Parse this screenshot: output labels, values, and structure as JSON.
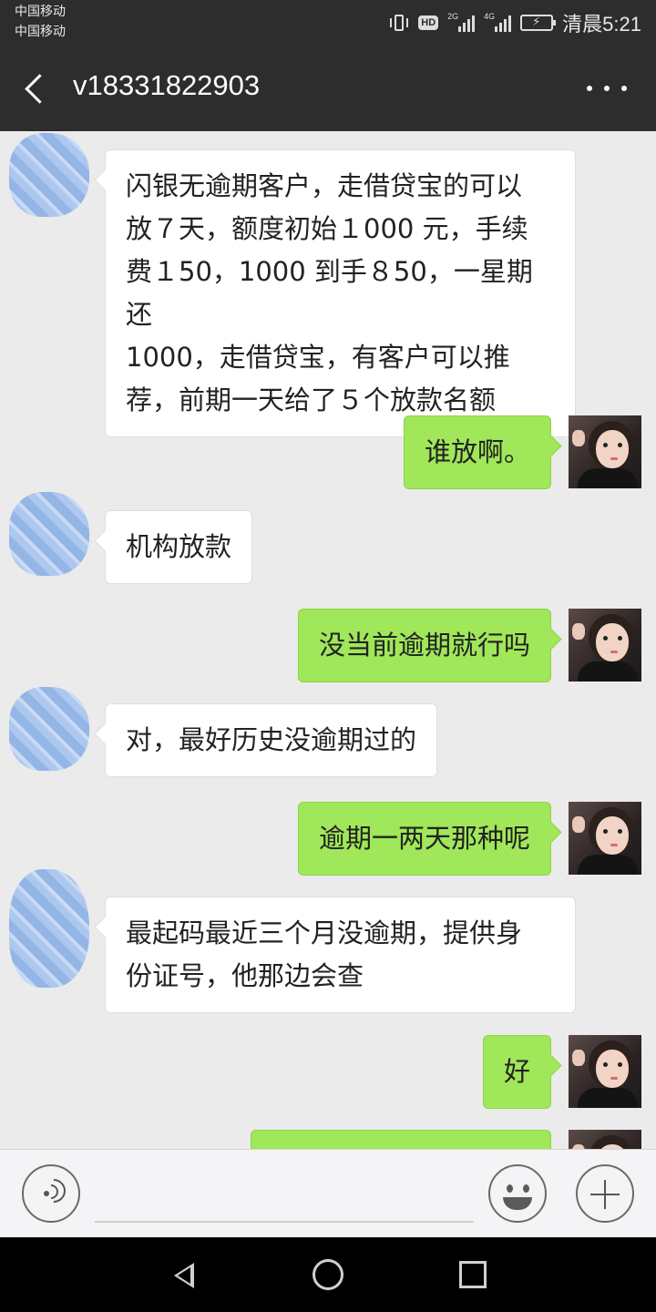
{
  "status_bar": {
    "carrier_1": "中国移动",
    "carrier_2": "中国移动",
    "hd_badge": "HD",
    "signal_1_label": "2G",
    "signal_2_label": "4G",
    "time": "清晨5:21"
  },
  "header": {
    "title": "v18331822903",
    "back_icon": "chevron-left-icon",
    "more_icon": "more-dots-icon"
  },
  "messages": [
    {
      "side": "in",
      "lines": [
        "闪银无逾期客户，走借贷宝的可以",
        "放７天，额度初始１000 元，手续",
        "费１50，1000 到手８50，一星期还",
        "1000，走借贷宝，有客户可以推",
        "荐，前期一天给了５个放款名额"
      ]
    },
    {
      "side": "out",
      "lines": [
        "谁放啊。"
      ]
    },
    {
      "side": "in",
      "lines": [
        "机构放款"
      ]
    },
    {
      "side": "out",
      "lines": [
        "没当前逾期就行吗"
      ]
    },
    {
      "side": "in",
      "lines": [
        "对，最好历史没逾期过的"
      ]
    },
    {
      "side": "out",
      "lines": [
        "逾期一两天那种呢"
      ]
    },
    {
      "side": "in",
      "lines": [
        "最起码最近三个月没逾期，提供身",
        "份证号，他那边会查"
      ]
    },
    {
      "side": "out",
      "lines": [
        "好"
      ]
    },
    {
      "side": "out",
      "lines": [
        ""
      ]
    }
  ],
  "input_bar": {
    "voice_icon": "voice-icon",
    "input_value": "",
    "emoji_icon": "emoji-icon",
    "add_icon": "plus-icon"
  },
  "colors": {
    "header_bg": "#2d2d2d",
    "chat_bg": "#ebebeb",
    "outgoing_bubble": "#a0e759",
    "incoming_bubble": "#ffffff"
  }
}
